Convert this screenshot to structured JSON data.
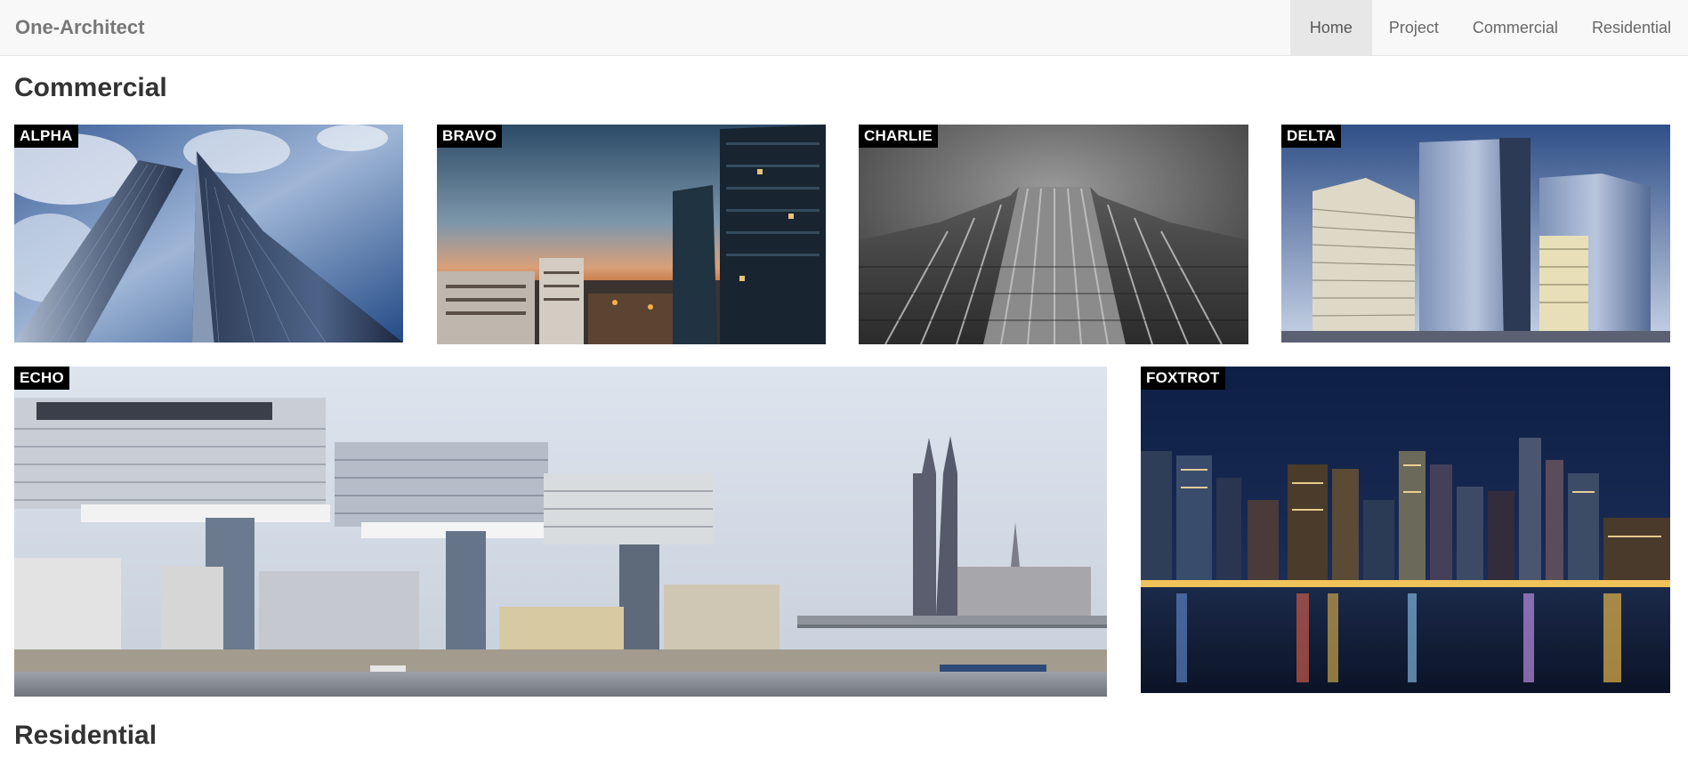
{
  "navbar": {
    "brand": "One-Architect",
    "items": [
      {
        "label": "Home",
        "active": true
      },
      {
        "label": "Project",
        "active": false
      },
      {
        "label": "Commercial",
        "active": false
      },
      {
        "label": "Residential",
        "active": false
      }
    ]
  },
  "sections": {
    "commercial": {
      "heading": "Commercial",
      "tiles": [
        {
          "label": "ALPHA"
        },
        {
          "label": "BRAVO"
        },
        {
          "label": "CHARLIE"
        },
        {
          "label": "DELTA"
        },
        {
          "label": "ECHO"
        },
        {
          "label": "FOXTROT"
        }
      ]
    },
    "residential": {
      "heading": "Residential"
    }
  },
  "colors": {
    "navbar_bg": "#f8f8f8",
    "active_nav_bg": "#e7e7e7",
    "label_bg": "#000000",
    "label_text": "#ffffff"
  }
}
